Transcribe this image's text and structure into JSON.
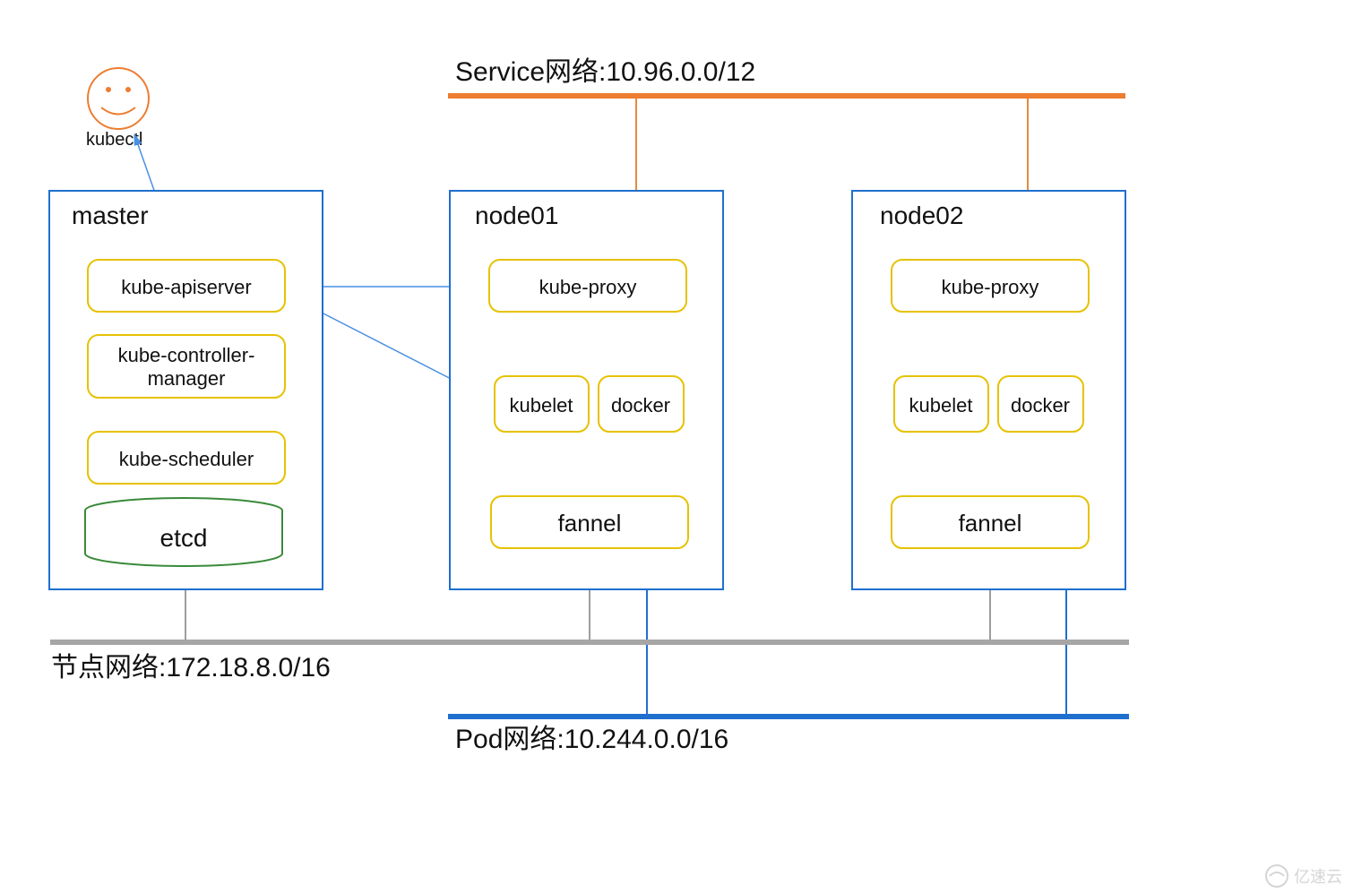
{
  "kubectl_label": "kubectl",
  "networks": {
    "service": "Service网络:10.96.0.0/12",
    "node": "节点网络:172.18.8.0/16",
    "pod": "Pod网络:10.244.0.0/16"
  },
  "master": {
    "title": "master",
    "components": {
      "apiserver": "kube-apiserver",
      "controller": "kube-controller-manager",
      "scheduler": "kube-scheduler",
      "etcd": "etcd"
    }
  },
  "node01": {
    "title": "node01",
    "components": {
      "proxy": "kube-proxy",
      "kubelet": "kubelet",
      "docker": "docker",
      "fannel": "fannel"
    }
  },
  "node02": {
    "title": "node02",
    "components": {
      "proxy": "kube-proxy",
      "kubelet": "kubelet",
      "docker": "docker",
      "fannel": "fannel"
    }
  },
  "watermark": "亿速云"
}
